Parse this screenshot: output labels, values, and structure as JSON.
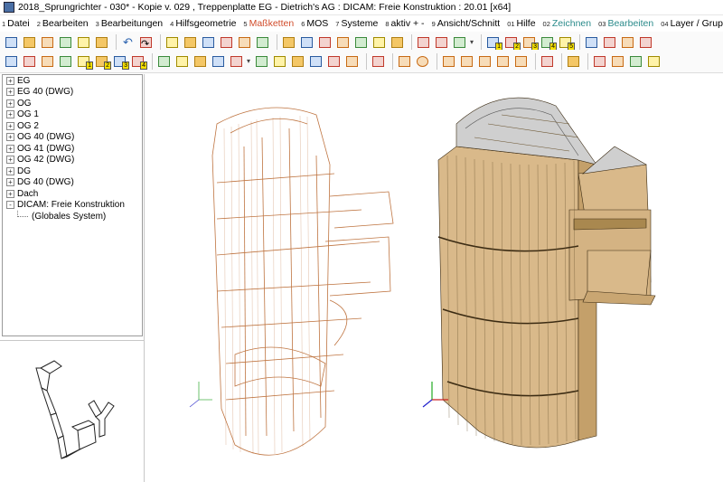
{
  "window": {
    "title": "2018_Sprungrichter - 030* - Kopie v. 029 , Treppenplatte EG - Dietrich's AG : DICAM: Freie Konstruktion : 20.01 [x64]"
  },
  "menubar": {
    "items": [
      {
        "num": "1",
        "label": "Datei",
        "accent": ""
      },
      {
        "num": "2",
        "label": "Bearbeiten",
        "accent": ""
      },
      {
        "num": "3",
        "label": "Bearbeitungen",
        "accent": ""
      },
      {
        "num": "4",
        "label": "Hilfsgeometrie",
        "accent": ""
      },
      {
        "num": "5",
        "label": "Maßketten",
        "accent": "red"
      },
      {
        "num": "6",
        "label": "MOS",
        "accent": ""
      },
      {
        "num": "7",
        "label": "Systeme",
        "accent": ""
      },
      {
        "num": "8",
        "label": "aktiv + -",
        "accent": ""
      },
      {
        "num": "9",
        "label": "Ansicht/Schnitt",
        "accent": ""
      },
      {
        "num": "01",
        "label": "Hilfe",
        "accent": ""
      },
      {
        "num": "02",
        "label": "Zeichnen",
        "accent": "teal"
      },
      {
        "num": "03",
        "label": "Bearbeiten",
        "accent": "teal"
      },
      {
        "num": "04",
        "label": "Layer / Gruppen",
        "accent": ""
      }
    ]
  },
  "toolbar1": {
    "buttons": [
      "new-file",
      "open-folder",
      "save",
      "save-as",
      "print-preview",
      "export",
      "sep",
      "undo",
      "redo",
      "sep",
      "view-front",
      "view-side",
      "view-layer",
      "view-print",
      "view-top",
      "house",
      "sep",
      "cube-1",
      "cube-2",
      "cube-3",
      "cube-4",
      "cube-5",
      "cube-6",
      "cube-7",
      "sep",
      "frame",
      "wall-red",
      "printer",
      "dropdown",
      "sep",
      "doc-1",
      "doc-2",
      "doc-3",
      "doc-4",
      "doc-5",
      "sep",
      "pencil-ruler",
      "angle",
      "gl-icon",
      "doc-red"
    ]
  },
  "toolbar2": {
    "buttons": [
      "layer-a",
      "layer-b",
      "layer-c",
      "layer-d",
      "layer-1",
      "layer-2",
      "layer-3",
      "layer-4",
      "sep",
      "plate-1",
      "plate-2",
      "plate-3",
      "plate-4",
      "plate-5",
      "dropdown",
      "plate-6",
      "plate-7",
      "plate-8",
      "plate-9",
      "plate-10",
      "plate-11",
      "sep",
      "cut-red",
      "sep",
      "rect-orange",
      "circle-orange",
      "sep",
      "beam-h",
      "beam-v",
      "beam-diag",
      "pencil",
      "beam-block",
      "sep",
      "red-tool",
      "sep",
      "green-tool",
      "sep",
      "merge-1",
      "merge-2",
      "merge-3",
      "merge-4"
    ],
    "badges": {
      "layer-1": "1",
      "layer-2": "2",
      "layer-3": "3",
      "layer-4": "4",
      "doc-1": "1",
      "doc-2": "2",
      "doc-3": "3",
      "doc-4": "4",
      "doc-5": "5"
    }
  },
  "tree": {
    "items": [
      {
        "label": "EG",
        "expander": "+"
      },
      {
        "label": "EG 40 (DWG)",
        "expander": "+"
      },
      {
        "label": "OG",
        "expander": "+"
      },
      {
        "label": "OG 1",
        "expander": "+"
      },
      {
        "label": "OG 2",
        "expander": "+"
      },
      {
        "label": "OG 40 (DWG)",
        "expander": "+"
      },
      {
        "label": "OG 41 (DWG)",
        "expander": "+"
      },
      {
        "label": "OG 42 (DWG)",
        "expander": "+"
      },
      {
        "label": "DG",
        "expander": "+"
      },
      {
        "label": "DG 40 (DWG)",
        "expander": "+"
      },
      {
        "label": "Dach",
        "expander": "+"
      },
      {
        "label": "DICAM: Freie Konstruktion",
        "expander": "-"
      }
    ],
    "child": {
      "label": "(Globales System)"
    }
  },
  "colors": {
    "wireframe": "#b8652c",
    "wood_face": "#d9b98a",
    "wood_dark": "#a9884f",
    "roof": "#cfcfcf",
    "accent_red": "#d14b2a",
    "accent_teal": "#2a8a8a"
  }
}
